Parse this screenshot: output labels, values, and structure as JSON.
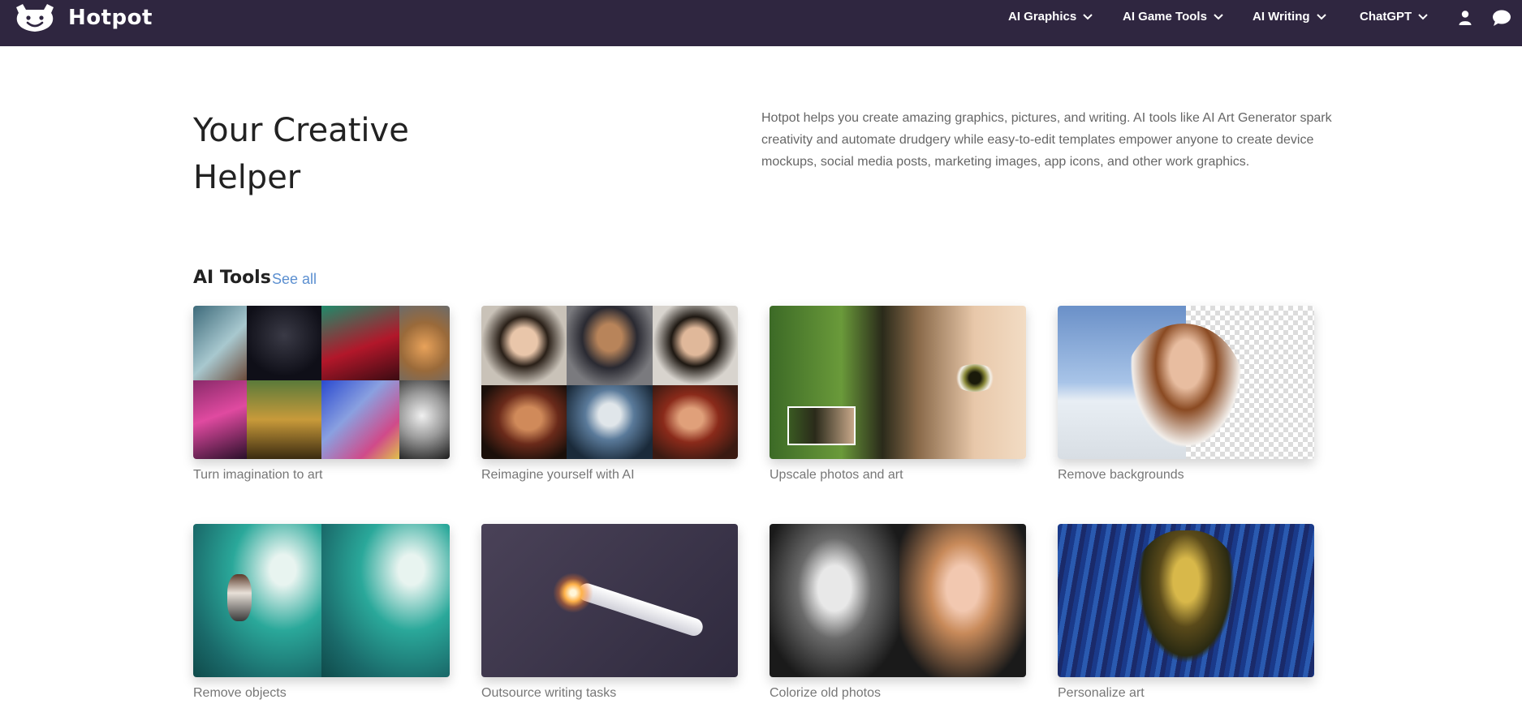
{
  "brand": {
    "name": "Hotpot",
    "logo_icon": "hotpot-mascot-icon"
  },
  "nav": {
    "items": [
      {
        "label": "AI Graphics",
        "icon": "chevron-down-icon"
      },
      {
        "label": "AI Game Tools",
        "icon": "chevron-down-icon"
      },
      {
        "label": "AI Writing",
        "icon": "chevron-down-icon"
      },
      {
        "label": "ChatGPT",
        "icon": "chevron-down-icon"
      }
    ],
    "user_icon": "user-icon",
    "chat_icon": "chat-bubble-icon"
  },
  "hero": {
    "title": "Your Creative Helper",
    "description": "Hotpot helps you create amazing graphics, pictures, and writing. AI tools like AI Art Generator spark creativity and automate drudgery while easy-to-edit templates empower anyone to create device mockups, social media posts, marketing images, app icons, and other work graphics."
  },
  "tools": {
    "title": "AI Tools",
    "see_all": "See all",
    "cards": [
      {
        "label": "Turn imagination to art"
      },
      {
        "label": "Reimagine yourself with AI"
      },
      {
        "label": "Upscale photos and art"
      },
      {
        "label": "Remove backgrounds"
      },
      {
        "label": "Remove objects"
      },
      {
        "label": "Outsource writing tasks"
      },
      {
        "label": "Colorize old photos"
      },
      {
        "label": "Personalize art"
      }
    ]
  },
  "colors": {
    "header_bg": "#2f2640",
    "link": "#5b8fd0",
    "caption": "#777777"
  }
}
